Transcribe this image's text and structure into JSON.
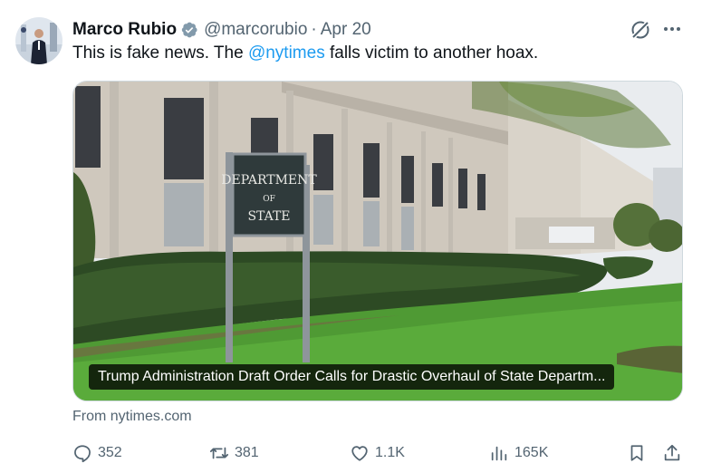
{
  "tweet": {
    "author_name": "Marco Rubio",
    "handle": "@marcorubio",
    "separator": "·",
    "date": "Apr 20",
    "text_before": "This is fake news. The ",
    "mention": "@nytimes",
    "text_after": " falls victim to another hoax."
  },
  "media": {
    "sign_line1": "DEPARTMENT",
    "sign_line2": "OF",
    "sign_line3": "STATE",
    "caption": "Trump Administration Draft Order Calls for Drastic Overhaul of State Departm..."
  },
  "source": "From nytimes.com",
  "actions": {
    "replies": "352",
    "reposts": "381",
    "likes": "1.1K",
    "views": "165K"
  },
  "icons": {
    "verified": "verified-badge-icon",
    "grok": "grok-icon",
    "more": "more-icon",
    "reply": "reply-icon",
    "repost": "repost-icon",
    "like": "heart-icon",
    "views": "views-icon",
    "bookmark": "bookmark-icon",
    "share": "share-icon"
  },
  "colors": {
    "text": "#0f1419",
    "secondary": "#536471",
    "link": "#1d9bf0",
    "verified_badge": "#829aab"
  }
}
